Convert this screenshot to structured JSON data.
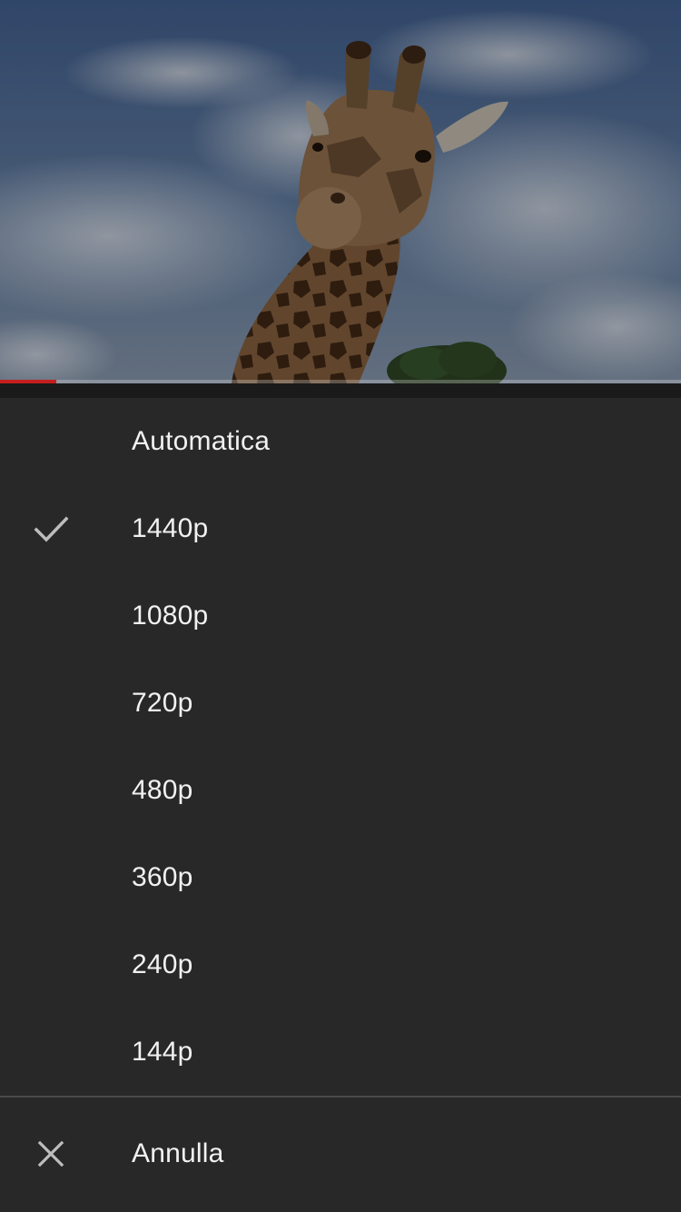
{
  "player": {
    "progress_fraction": 0.083
  },
  "quality_menu": {
    "selected_index": 1,
    "options": [
      {
        "label": "Automatica"
      },
      {
        "label": "1440p"
      },
      {
        "label": "1080p"
      },
      {
        "label": "720p"
      },
      {
        "label": "480p"
      },
      {
        "label": "360p"
      },
      {
        "label": "240p"
      },
      {
        "label": "144p"
      }
    ],
    "cancel_label": "Annulla"
  },
  "icons": {
    "selected": "checkmark-icon",
    "cancel": "close-icon"
  },
  "colors": {
    "sheet_background": "#282828",
    "text": "#f1f1f1",
    "icon": "#bdbdbd",
    "progress": "#c41e1e"
  }
}
